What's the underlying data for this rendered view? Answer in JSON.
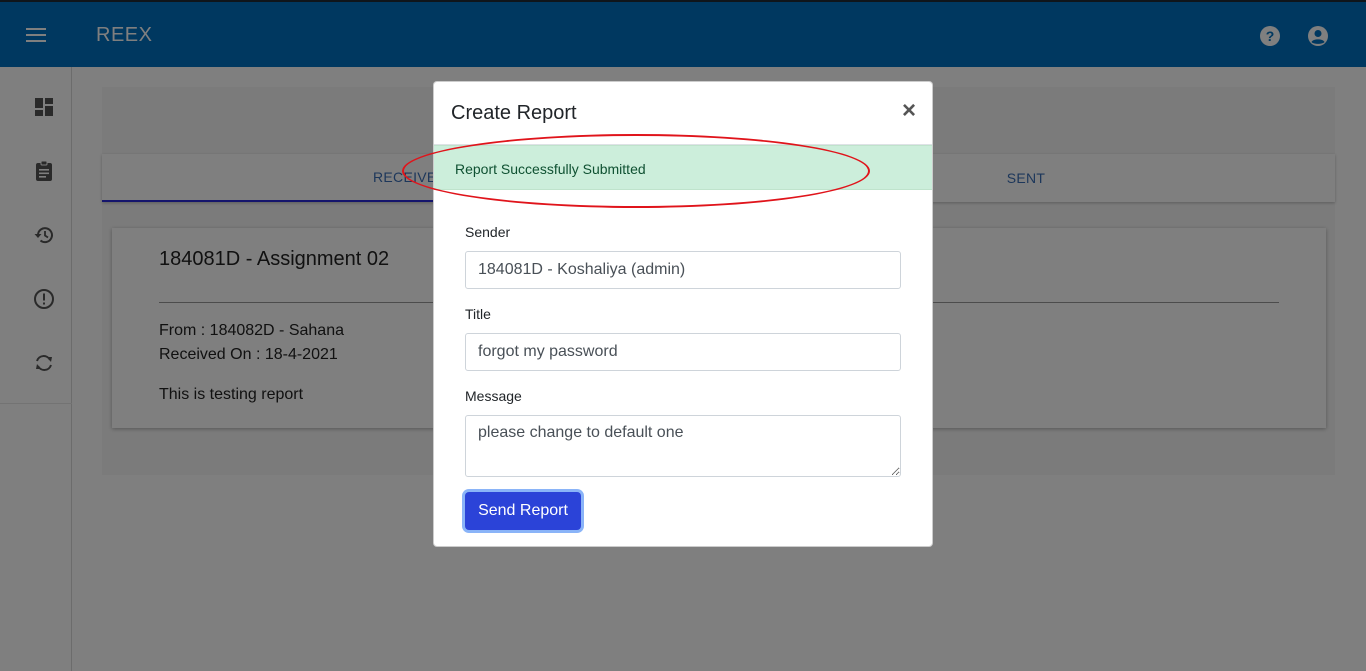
{
  "appbar": {
    "brand": "REEX",
    "menu_icon": "hamburger-menu-icon",
    "help_icon": "help-circle-icon",
    "account_icon": "account-circle-icon",
    "background": "#0070c0"
  },
  "sidebar": {
    "items": [
      {
        "icon": "dashboard-icon"
      },
      {
        "icon": "clipboard-report-icon"
      },
      {
        "icon": "history-icon"
      },
      {
        "icon": "alert-circle-icon"
      },
      {
        "icon": "sync-icon"
      }
    ]
  },
  "main": {
    "tabs": [
      {
        "label": "Received",
        "active": true
      },
      {
        "label": "Sent",
        "active": false
      }
    ],
    "report": {
      "title": "184081D - Assignment 02",
      "from": "From : 184082D - Sahana",
      "received_on": "Received On : 18-4-2021",
      "body": "This is testing report"
    }
  },
  "modal": {
    "title": "Create Report",
    "close_symbol": "×",
    "alert": {
      "text": "Report Successfully Submitted",
      "color": "#cceedb"
    },
    "fields": {
      "sender": {
        "label": "Sender",
        "value": "184081D - Koshaliya (admin)"
      },
      "title": {
        "label": "Title",
        "value": "forgot my password"
      },
      "message": {
        "label": "Message",
        "value": "please change to default one"
      }
    },
    "send_button": "Send Report",
    "accent": "#2b43d8"
  },
  "annotation": {
    "color": "#e0141b",
    "shape": "ellipse"
  }
}
